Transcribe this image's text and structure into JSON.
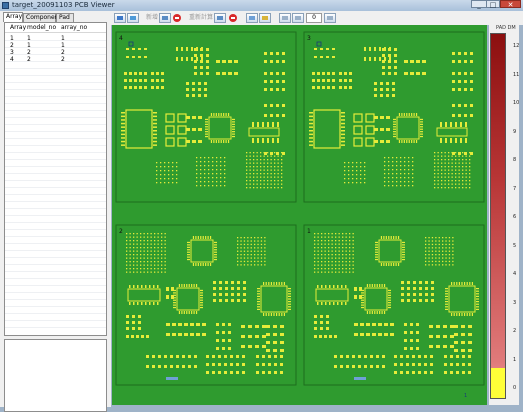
{
  "window": {
    "title": "target_20091103 PCB Viewer",
    "min": "_",
    "max": "□",
    "close": "✕"
  },
  "tabs": [
    {
      "label": "Array",
      "active": true
    },
    {
      "label": "Component",
      "active": false
    },
    {
      "label": "Pad",
      "active": false
    }
  ],
  "table": {
    "columns": [
      "Array",
      "model_no",
      "array_no"
    ],
    "rows": [
      [
        "1",
        "1",
        "1"
      ],
      [
        "2",
        "1",
        "1"
      ],
      [
        "3",
        "2",
        "2"
      ],
      [
        "4",
        "2",
        "2"
      ]
    ]
  },
  "toolbar": {
    "label1": "新增",
    "label2": "重新計算",
    "zoom_value": "0"
  },
  "scale": {
    "title": "PAD DM",
    "ticks": [
      "12",
      "11",
      "10",
      "9",
      "8",
      "7",
      "6",
      "5",
      "4",
      "3",
      "2",
      "1",
      "0"
    ]
  },
  "pcb": {
    "board_color": "#2f9b2f",
    "pad_color": "#e6ec3a",
    "arrays": [
      {
        "label": "4"
      },
      {
        "label": "3"
      },
      {
        "label": "2"
      },
      {
        "label": "1"
      }
    ],
    "fiducial": "1"
  }
}
